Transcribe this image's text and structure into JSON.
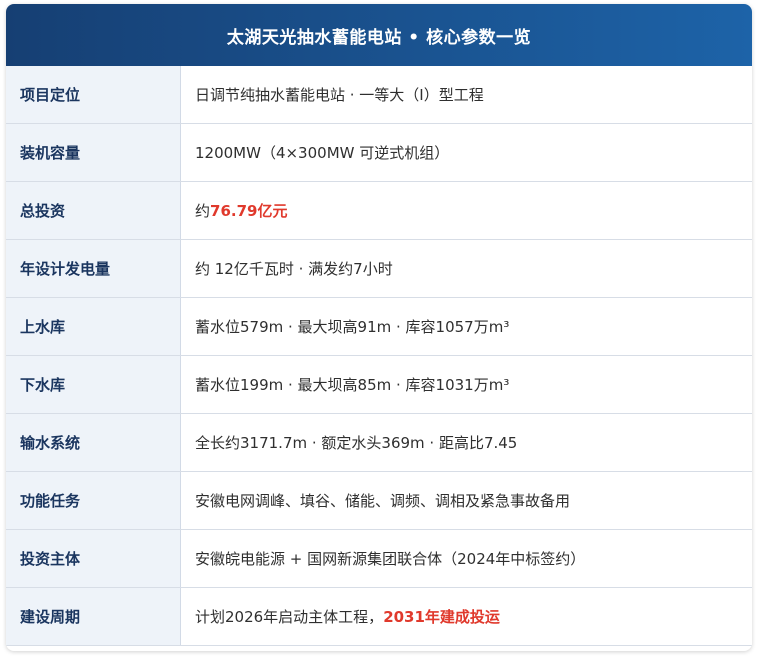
{
  "title": "太湖天光抽水蓄能电站 • 核心参数一览",
  "rows": [
    {
      "label": "项目定位",
      "prefix": "日调节纯抽水蓄能电站 · 一等大（Ⅰ）型工程",
      "highlight": "",
      "suffix": ""
    },
    {
      "label": "装机容量",
      "prefix": "1200MW（4×300MW 可逆式机组）",
      "highlight": "",
      "suffix": ""
    },
    {
      "label": "总投资",
      "prefix": "约",
      "highlight": "76.79亿元",
      "suffix": ""
    },
    {
      "label": "年设计发电量",
      "prefix": "约 12亿千瓦时 · 满发约7小时",
      "highlight": "",
      "suffix": ""
    },
    {
      "label": "上水库",
      "prefix": "蓄水位579m · 最大坝高91m · 库容1057万m³",
      "highlight": "",
      "suffix": ""
    },
    {
      "label": "下水库",
      "prefix": "蓄水位199m · 最大坝高85m · 库容1031万m³",
      "highlight": "",
      "suffix": ""
    },
    {
      "label": "输水系统",
      "prefix": "全长约3171.7m · 额定水头369m · 距高比7.45",
      "highlight": "",
      "suffix": ""
    },
    {
      "label": "功能任务",
      "prefix": "安徽电网调峰、填谷、储能、调频、调相及紧急事故备用",
      "highlight": "",
      "suffix": ""
    },
    {
      "label": "投资主体",
      "prefix": "安徽皖电能源 + 国网新源集团联合体（2024年中标签约）",
      "highlight": "",
      "suffix": ""
    },
    {
      "label": "建设周期",
      "prefix": "计划2026年启动主体工程，",
      "highlight": "2031年建成投运",
      "suffix": ""
    }
  ],
  "colors": {
    "header_start": "#163f73",
    "header_end": "#1d63a8",
    "label_bg": "#eef3f9",
    "label_text": "#1a355f",
    "highlight": "#e0392c"
  }
}
